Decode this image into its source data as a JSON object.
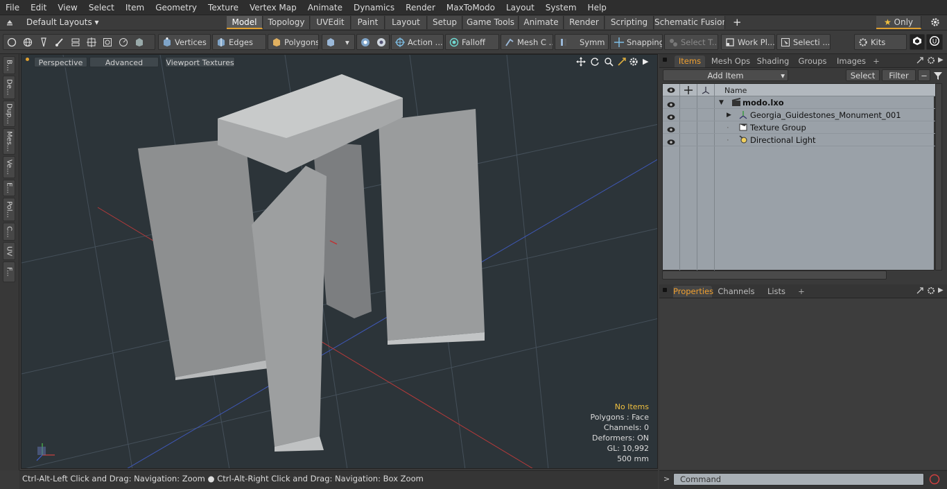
{
  "menu": [
    "File",
    "Edit",
    "View",
    "Select",
    "Item",
    "Geometry",
    "Texture",
    "Vertex Map",
    "Animate",
    "Dynamics",
    "Render",
    "MaxToModo",
    "Layout",
    "System",
    "Help"
  ],
  "layoutbar": {
    "layouts_label": "Default Layouts",
    "tabs": [
      "Model",
      "Topology",
      "UVEdit",
      "Paint",
      "Layout",
      "Setup",
      "Game Tools",
      "Animate",
      "Render",
      "Scripting",
      "Schematic Fusion"
    ],
    "active_tab": "Model",
    "only_label": "Only"
  },
  "toolbar": {
    "vertices": "Vertices",
    "edges": "Edges",
    "polygons": "Polygons",
    "action": "Action ...",
    "falloff": "Falloff",
    "mesh": "Mesh C ...",
    "symm": "Symm ...",
    "snapping": "Snapping",
    "select_t": "Select T...",
    "work_plane": "Work Pl...",
    "selection": "Selecti ...",
    "kits": "Kits"
  },
  "left_tabs": [
    "B...",
    "De...",
    "Dup...",
    "Mes...",
    "Ve...",
    "E...",
    "Pol...",
    "C...",
    "UV",
    "F..."
  ],
  "viewport": {
    "perspective": "Perspective",
    "advanced": "Advanced",
    "viewport_textures": "Viewport Textures",
    "info": {
      "no_items": "No Items",
      "polygons": "Polygons : Face",
      "channels": "Channels: 0",
      "deformers": "Deformers: ON",
      "gl": "GL: 10,992",
      "scale": "500 mm"
    }
  },
  "status": "Ctrl-Alt-Left Click and Drag: Navigation: Zoom ● Ctrl-Alt-Right Click and Drag: Navigation: Box Zoom",
  "items_panel": {
    "tabs": [
      "Items",
      "Mesh Ops",
      "Shading",
      "Groups",
      "Images"
    ],
    "active_tab": "Items",
    "add_item": "Add Item",
    "select": "Select",
    "filter": "Filter",
    "col_name": "Name",
    "rows": [
      {
        "name": "modo.lxo",
        "bold": true
      },
      {
        "name": "Georgia_Guidestones_Monument_001",
        "bold": false
      },
      {
        "name": "Texture Group",
        "bold": false
      },
      {
        "name": "Directional Light",
        "bold": false
      }
    ]
  },
  "properties_panel": {
    "tabs": [
      "Properties",
      "Channels",
      "Lists"
    ],
    "active_tab": "Properties"
  },
  "command": {
    "placeholder": "Command"
  }
}
